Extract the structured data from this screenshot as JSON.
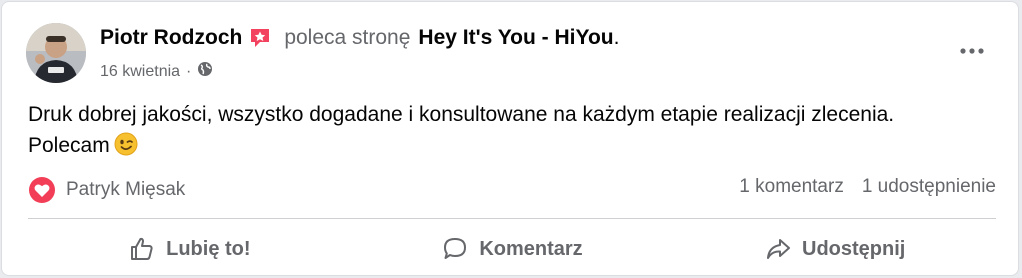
{
  "post": {
    "author": "Piotr Rodzoch",
    "recommends_text": "poleca stronę",
    "page_name": "Hey It's You - HiYou",
    "page_suffix": ".",
    "date": "16 kwietnia",
    "separator": "·",
    "text_line1": "Druk dobrej jakości, wszystko dogadane i konsultowane na każdym etapie realizacji zlecenia.",
    "text_line2": "Polecam"
  },
  "reactions": {
    "user": "Patryk Mięsak",
    "comments": "1 komentarz",
    "shares": "1 udostępnienie"
  },
  "actions": {
    "like": "Lubię to!",
    "comment": "Komentarz",
    "share": "Udostępnij"
  },
  "colors": {
    "recommend_badge": "#f3425f",
    "heart": "#f33e58",
    "text_primary": "#050505",
    "text_secondary": "#65676b"
  },
  "icons": [
    "recommend-badge-icon",
    "globe-icon",
    "more-options-icon",
    "wink-emoji-icon",
    "heart-reaction-icon",
    "thumbs-up-icon",
    "comment-icon",
    "share-icon"
  ]
}
